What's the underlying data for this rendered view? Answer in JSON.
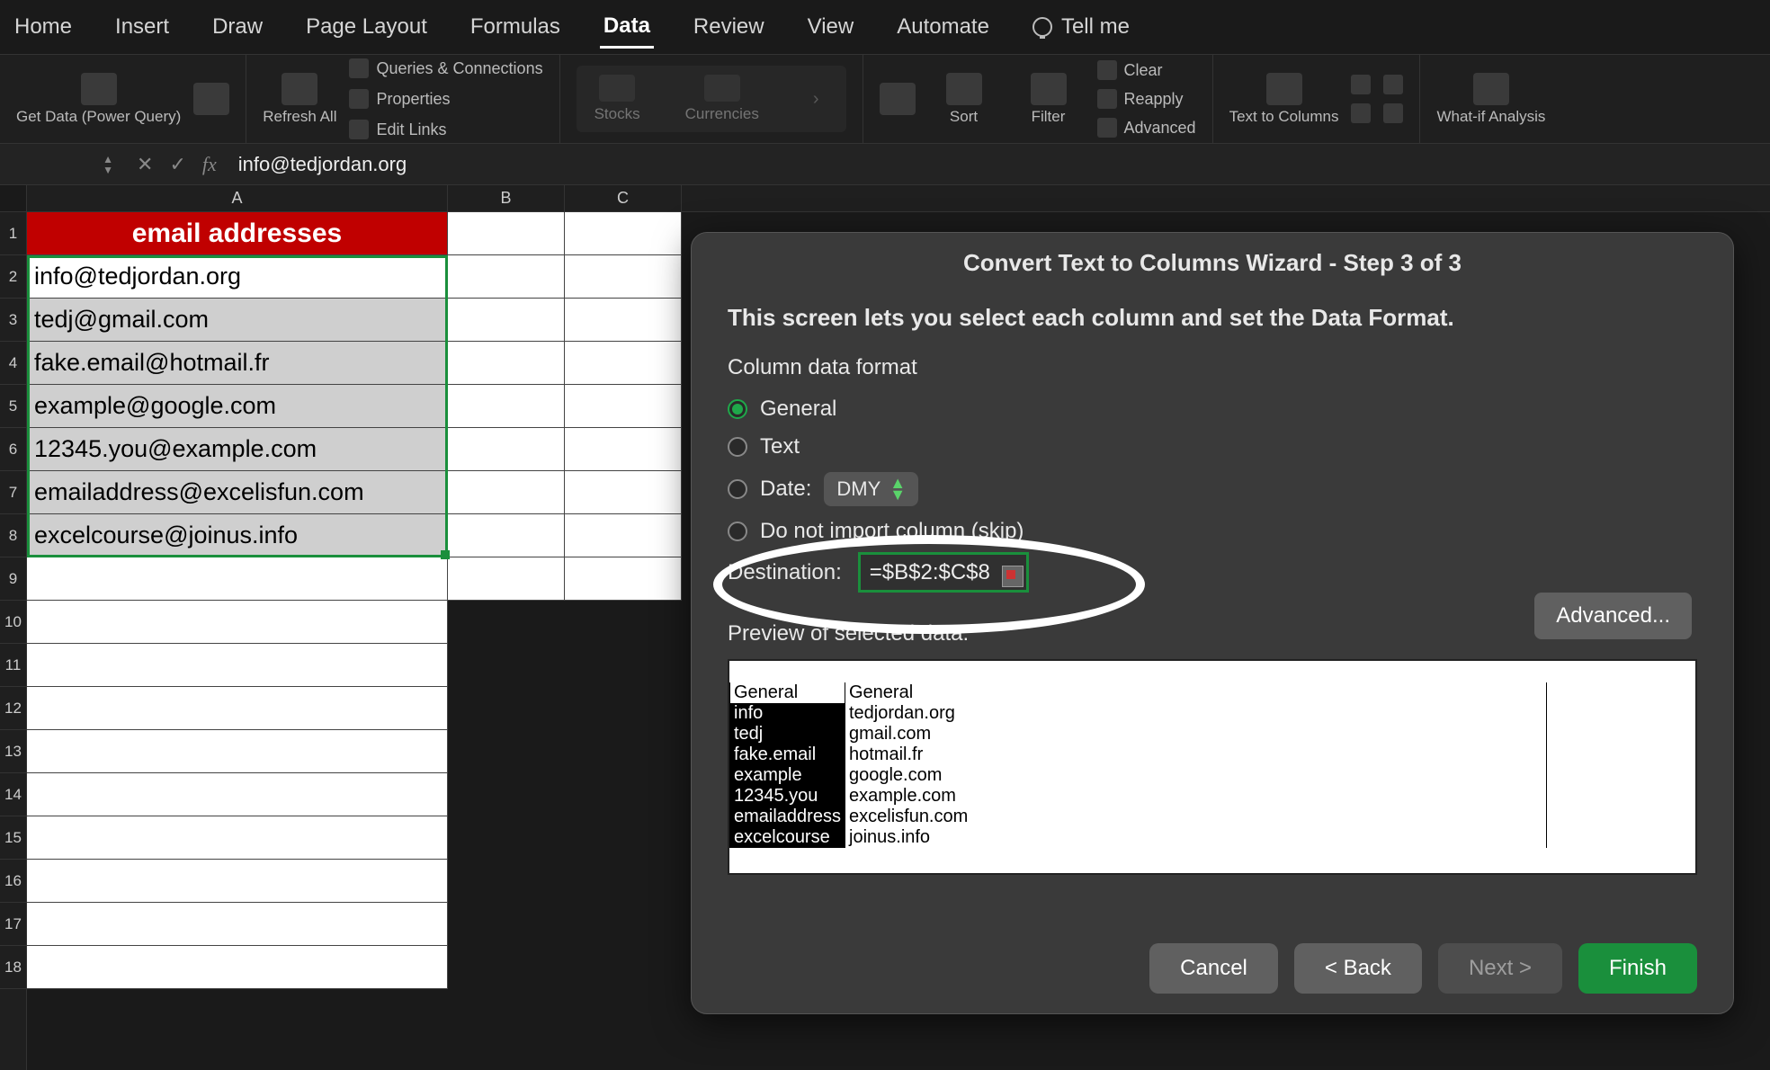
{
  "ribbon_tabs": {
    "home": "Home",
    "insert": "Insert",
    "draw": "Draw",
    "page_layout": "Page Layout",
    "formulas": "Formulas",
    "data": "Data",
    "review": "Review",
    "view": "View",
    "automate": "Automate",
    "tell_me": "Tell me"
  },
  "ribbon": {
    "get_data": "Get Data (Power Query)",
    "refresh_all": "Refresh All",
    "queries": "Queries & Connections",
    "properties": "Properties",
    "edit_links": "Edit Links",
    "stocks": "Stocks",
    "currencies": "Currencies",
    "sort": "Sort",
    "filter": "Filter",
    "clear": "Clear",
    "reapply": "Reapply",
    "advanced": "Advanced",
    "text_to_cols": "Text to Columns",
    "whatif": "What-if Analysis"
  },
  "formula_bar": {
    "value": "info@tedjordan.org"
  },
  "columns": {
    "a": "A",
    "b": "B",
    "c": "C"
  },
  "rows": [
    "1",
    "2",
    "3",
    "4",
    "5",
    "6",
    "7",
    "8",
    "9",
    "10",
    "11",
    "12",
    "13",
    "14",
    "15",
    "16",
    "17",
    "18"
  ],
  "sheet": {
    "header": "email addresses",
    "data": [
      "info@tedjordan.org",
      "tedj@gmail.com",
      "fake.email@hotmail.fr",
      "example@google.com",
      "12345.you@example.com",
      "emailaddress@excelisfun.com",
      "excelcourse@joinus.info"
    ]
  },
  "dialog": {
    "title": "Convert Text to Columns Wizard - Step 3 of 3",
    "heading": "This screen lets you select each column and set the Data Format.",
    "section": "Column data format",
    "opts": {
      "general": "General",
      "text": "Text",
      "date": "Date:",
      "date_fmt": "DMY",
      "skip": "Do not import column (skip)"
    },
    "dest_label": "Destination:",
    "dest_value": "=$B$2:$C$8",
    "advanced": "Advanced...",
    "preview_label": "Preview of selected data:",
    "preview": {
      "hdr1": "General",
      "hdr2": "General",
      "rows": [
        [
          "info",
          "tedjordan.org"
        ],
        [
          "tedj",
          "gmail.com"
        ],
        [
          "fake.email",
          "hotmail.fr"
        ],
        [
          "example",
          "google.com"
        ],
        [
          "12345.you",
          "example.com"
        ],
        [
          "emailaddress",
          "excelisfun.com"
        ],
        [
          "excelcourse",
          "joinus.info"
        ]
      ]
    },
    "buttons": {
      "cancel": "Cancel",
      "back": "< Back",
      "next": "Next >",
      "finish": "Finish"
    }
  }
}
